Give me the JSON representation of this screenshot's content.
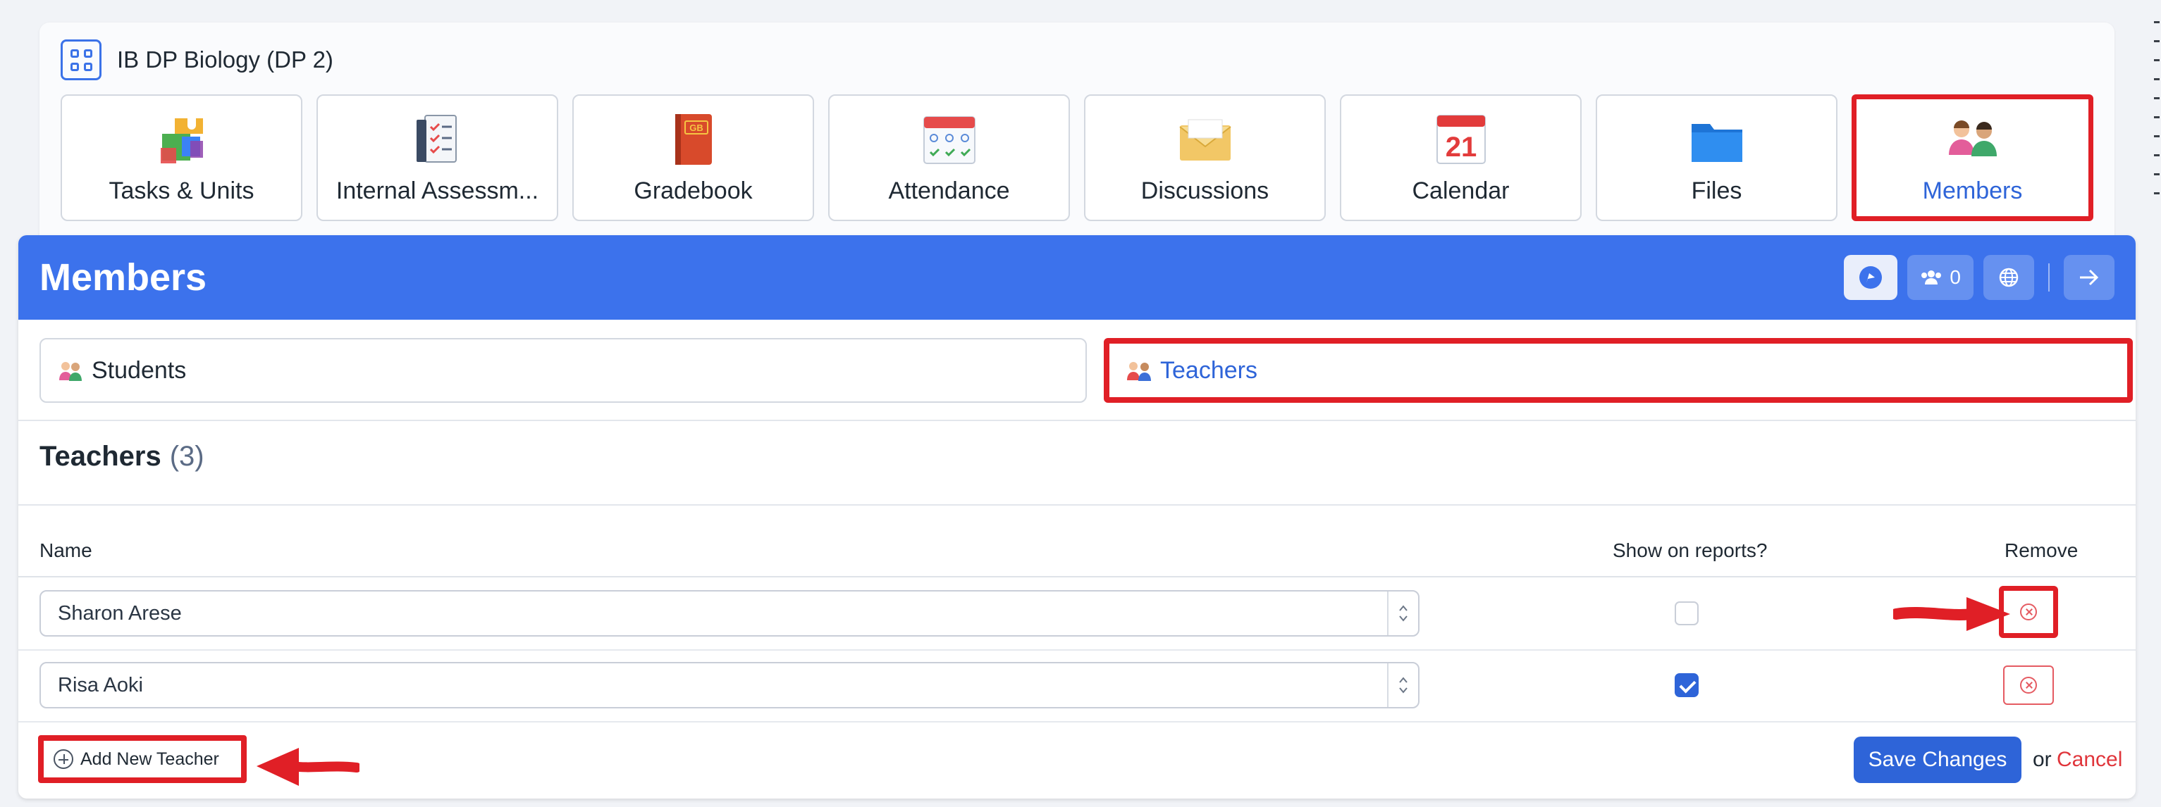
{
  "course": {
    "title": "IB DP Biology (DP 2)"
  },
  "tools": [
    {
      "label": "Tasks & Units",
      "icon": "puzzle-icon"
    },
    {
      "label": "Internal Assessm...",
      "icon": "checklist-icon"
    },
    {
      "label": "Gradebook",
      "icon": "gradebook-icon"
    },
    {
      "label": "Attendance",
      "icon": "attendance-icon"
    },
    {
      "label": "Discussions",
      "icon": "envelope-icon"
    },
    {
      "label": "Calendar",
      "icon": "calendar-icon",
      "calendar_day": "21"
    },
    {
      "label": "Files",
      "icon": "folder-icon"
    },
    {
      "label": "Members",
      "icon": "members-icon",
      "active": true
    }
  ],
  "panel": {
    "title": "Members",
    "member_count": "0"
  },
  "subtabs": {
    "students": "Students",
    "teachers": "Teachers"
  },
  "section": {
    "title": "Teachers",
    "count": "(3)"
  },
  "table": {
    "headers": {
      "name": "Name",
      "show": "Show on reports?",
      "remove": "Remove"
    },
    "rows": [
      {
        "name": "Sharon Arese",
        "show_on_reports": false
      },
      {
        "name": "Risa Aoki",
        "show_on_reports": true
      }
    ]
  },
  "footer": {
    "add_label": "Add New Teacher",
    "save_label": "Save Changes",
    "or_label": "or",
    "cancel_label": "Cancel"
  },
  "colors": {
    "accent": "#3c72ec",
    "highlight": "#e01f26",
    "danger": "#e55b62"
  }
}
